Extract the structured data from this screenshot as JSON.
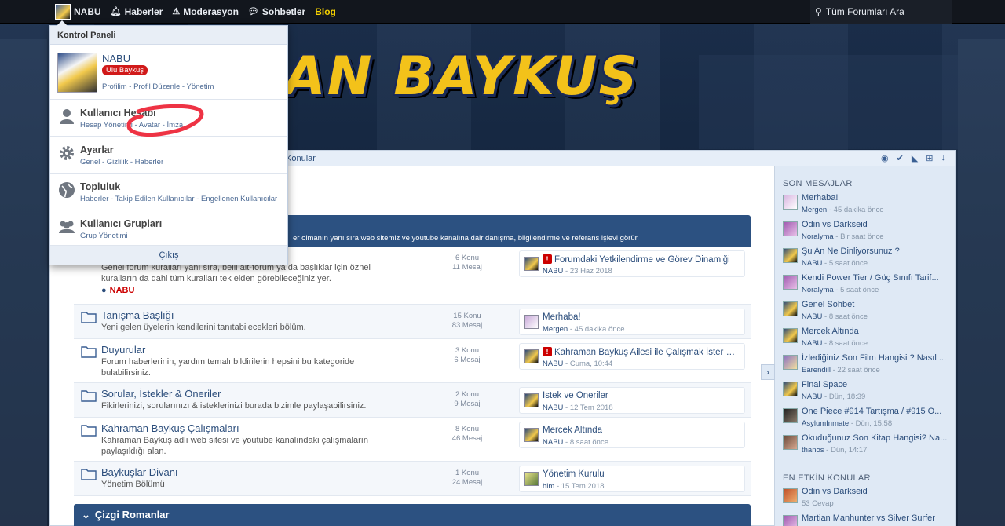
{
  "topnav": {
    "user": "NABU",
    "items": [
      {
        "label": "Haberler",
        "icon": "bell-icon"
      },
      {
        "label": "Moderasyon",
        "icon": "warning-icon"
      },
      {
        "label": "Sohbetler",
        "icon": "chat-icon"
      },
      {
        "label": "Blog",
        "icon": ""
      }
    ],
    "search_label": "Tüm Forumları Ara"
  },
  "logo": "AN BAYKUŞ",
  "breadcrumb": "Konular",
  "dropdown": {
    "header": "Kontrol Paneli",
    "profile": {
      "name": "NABU",
      "rank": "Ulu Baykuş",
      "links": "Profilim - Profil Düzenle - Yönetim"
    },
    "sections": [
      {
        "title": "Kullanıcı Hesabı",
        "links": "Hesap Yönetimi - Avatar - İmza",
        "icon": "user-icon"
      },
      {
        "title": "Ayarlar",
        "links": "Genel - Gizlilik - Haberler",
        "icon": "gear-icon"
      },
      {
        "title": "Topluluk",
        "links": "Haberler - Takip Edilen Kullanıcılar - Engellenen Kullanıcılar",
        "icon": "globe-icon"
      },
      {
        "title": "Kullanıcı Grupları",
        "links": "Grup Yönetimi",
        "icon": "users-icon"
      }
    ],
    "logout": "Çıkış"
  },
  "forum": {
    "head_desc": "er olmanın yanı sıra web sitemiz ve youtube kanalına dair danışma, bilgilendirme ve referans işlevi görür.",
    "nodes": [
      {
        "title": "",
        "desc": "Genel forum kuralları yanı sıra, belli alt-forum ya da başlıklar için öznel kuralların da dahi tüm kuralları tek elden görebileceğiniz yer.",
        "user": "NABU",
        "topics": "6 Konu",
        "posts": "11 Mesaj",
        "last_title": "Forumdaki Yetkilendirme ve Görev Dinamiği",
        "last_user": "NABU",
        "last_time": "23 Haz 2018",
        "alert": true
      },
      {
        "title": "Tanışma Başlığı",
        "desc": "Yeni gelen üyelerin kendilerini tanıtabilecekleri bölüm.",
        "topics": "15 Konu",
        "posts": "83 Mesaj",
        "last_title": "Merhaba!",
        "last_user": "Mergen",
        "last_time": "45 dakika önce",
        "alert": false
      },
      {
        "title": "Duyurular",
        "desc": "Forum haberlerinin, yardım temalı bildirilerin hepsini bu kategoride bulabilirsiniz.",
        "topics": "3 Konu",
        "posts": "6 Mesaj",
        "last_title": "Kahraman Baykuş Ailesi ile Çalışmak İster m...",
        "last_user": "NABU",
        "last_time": "Cuma, 10:44",
        "alert": true
      },
      {
        "title": "Sorular, İstekler & Öneriler",
        "desc": "Fikirlerinizi, sorularınızı & isteklerinizi burada bizimle paylaşabilirsiniz.",
        "topics": "2 Konu",
        "posts": "9 Mesaj",
        "last_title": "İstek ve Öneriler",
        "last_user": "NABU",
        "last_time": "12 Tem 2018",
        "alert": false
      },
      {
        "title": "Kahraman Baykuş Çalışmaları",
        "desc": "Kahraman Baykuş adlı web sitesi ve youtube kanalındaki çalışmaların paylaşıldığı alan.",
        "topics": "8 Konu",
        "posts": "46 Mesaj",
        "last_title": "Mercek Altında",
        "last_user": "NABU",
        "last_time": "8 saat önce",
        "alert": false
      },
      {
        "title": "Baykuşlar Divanı",
        "desc": "Yönetim Bölümü",
        "topics": "1 Konu",
        "posts": "24 Mesaj",
        "last_title": "Yönetim Kurulu",
        "last_user": "hlm",
        "last_time": "15 Tem 2018",
        "alert": false
      }
    ],
    "category2": "Çizgi Romanlar"
  },
  "sidebar": {
    "recent_head": "SON MESAJLAR",
    "recent": [
      {
        "title": "Merhaba!",
        "user": "Mergen",
        "time": "45 dakika önce"
      },
      {
        "title": "Odin vs Darkseid",
        "user": "Noralyma",
        "time": "Bir saat önce"
      },
      {
        "title": "Şu An Ne Dinliyorsunuz ?",
        "user": "NABU",
        "time": "5 saat önce"
      },
      {
        "title": "Kendi Power Tier / Güç Sınıfı Tarif...",
        "user": "Noralyma",
        "time": "5 saat önce"
      },
      {
        "title": "Genel Sohbet",
        "user": "NABU",
        "time": "8 saat önce"
      },
      {
        "title": "Mercek Altında",
        "user": "NABU",
        "time": "8 saat önce"
      },
      {
        "title": "İzlediğiniz Son Film Hangisi ? Nasıl ...",
        "user": "Earendill",
        "time": "22 saat önce"
      },
      {
        "title": "Final Space",
        "user": "NABU",
        "time": "Dün, 18:39"
      },
      {
        "title": "One Piece #914 Tartışma / #915 Ö...",
        "user": "AsylumInmate",
        "time": "Dün, 15:58"
      },
      {
        "title": "Okuduğunuz Son Kitap Hangisi? Na...",
        "user": "thanos",
        "time": "Dün, 14:17"
      }
    ],
    "active_head": "EN ETKİN KONULAR",
    "active": [
      {
        "title": "Odin vs Darkseid",
        "meta": "53 Cevap"
      },
      {
        "title": "Martian Manhunter vs Silver Surfer",
        "meta": ""
      }
    ]
  }
}
